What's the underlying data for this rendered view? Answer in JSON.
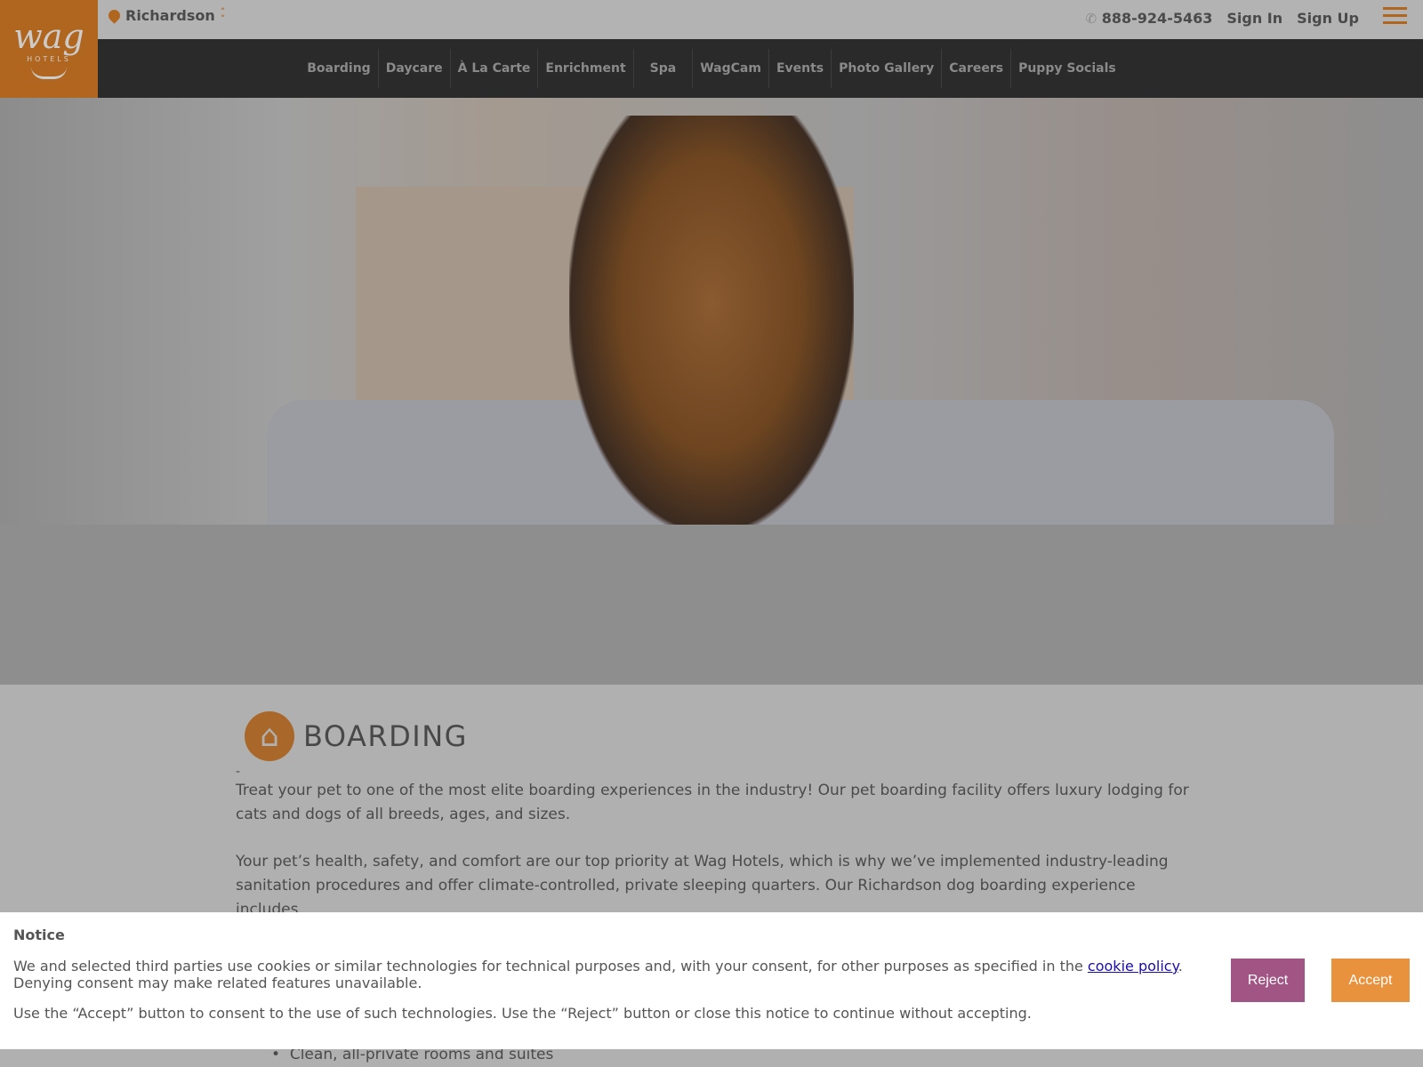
{
  "brand": {
    "logo_text": "wag",
    "logo_sub": "HOTELS",
    "accent": "#b1661f"
  },
  "location": {
    "name": "Richardson"
  },
  "header": {
    "phone": "888-924-5463",
    "sign_in": "Sign In",
    "sign_up": "Sign Up"
  },
  "nav": [
    "Boarding",
    "Daycare",
    "À La Carte",
    "Enrichment",
    "Spa",
    "WagCam",
    "Events",
    "Photo Gallery",
    "Careers",
    "Puppy Socials"
  ],
  "section": {
    "title": "BOARDING",
    "dash": "-",
    "paragraphs": [
      "Treat your pet to one of the most elite boarding experiences in the industry! Our pet boarding facility offers luxury lodging for cats and dogs of all breeds, ages, and sizes.",
      "Your pet’s health, safety, and comfort are our top priority at Wag Hotels, which is why we’ve implemented industry-leading sanitation procedures and offer climate-controlled, private sleeping quarters. Our Richardson dog boarding experience includes"
    ],
    "bullets": [
      "Clean, all-private rooms and suites"
    ]
  },
  "cookie": {
    "title": "Notice",
    "text1": "We and selected third parties use cookies or similar technologies for technical purposes and, with your consent, for other purposes as specified in the ",
    "link": "cookie policy",
    "text1_end": ". Denying consent may make related features unavailable.",
    "text2": "Use the “Accept” button to consent to the use of such technologies. Use the “Reject” button or close this notice to continue without accepting.",
    "reject": "Reject",
    "accept": "Accept"
  }
}
